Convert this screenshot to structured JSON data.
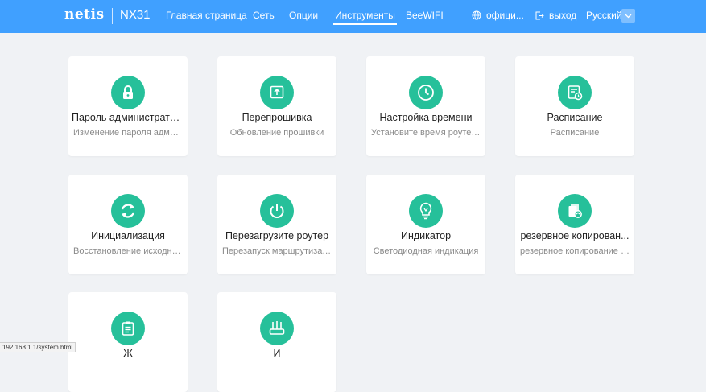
{
  "header": {
    "brand": "netis",
    "model": "NX31",
    "nav": [
      {
        "label": "Главная страница"
      },
      {
        "label": "Сеть"
      },
      {
        "label": "Опции"
      },
      {
        "label": "Инструменты",
        "active": true
      },
      {
        "label": "BeeWIFI"
      }
    ],
    "official_label": "офици...",
    "logout_label": "выход",
    "language": "Русский"
  },
  "cards": [
    {
      "icon": "lock-icon",
      "title": "Пароль администратора",
      "desc": "Изменение пароля админ..."
    },
    {
      "icon": "upload-icon",
      "title": "Перепрошивка",
      "desc": "Обновление прошивки"
    },
    {
      "icon": "clock-icon",
      "title": "Настройка времени",
      "desc": "Установите время роутера"
    },
    {
      "icon": "schedule-icon",
      "title": "Расписание",
      "desc": "Расписание"
    },
    {
      "icon": "reset-icon",
      "title": "Инициализация",
      "desc": "Восстановление исходног..."
    },
    {
      "icon": "power-icon",
      "title": "Перезагрузите роутер",
      "desc": "Перезапуск маршрутизат..."
    },
    {
      "icon": "bulb-icon",
      "title": "Индикатор",
      "desc": "Светодиодная индикация"
    },
    {
      "icon": "backup-icon",
      "title": "резервное копирован...",
      "desc": "резервное копирование п..."
    },
    {
      "icon": "clipboard-icon",
      "title": "Ж",
      "desc": ""
    },
    {
      "icon": "router-icon",
      "title": "И",
      "desc": ""
    }
  ],
  "status_url": "192.168.1.1/system.html",
  "colors": {
    "header": "#40a0ff",
    "icon_bg": "#26c09a",
    "page_bg": "#f0f2f5"
  }
}
